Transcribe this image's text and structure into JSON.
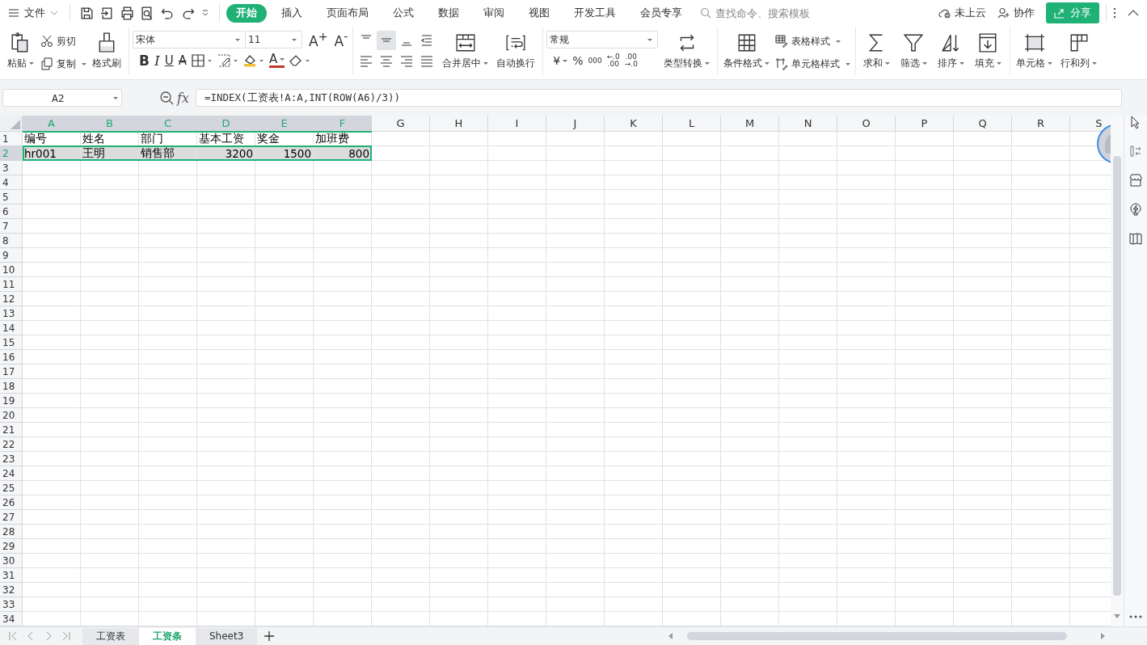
{
  "menu_bar": {
    "file_menu": "文件",
    "tabs": [
      {
        "label": "开始",
        "selected": true
      },
      {
        "label": "插入",
        "selected": false
      },
      {
        "label": "页面布局",
        "selected": false
      },
      {
        "label": "公式",
        "selected": false
      },
      {
        "label": "数据",
        "selected": false
      },
      {
        "label": "审阅",
        "selected": false
      },
      {
        "label": "视图",
        "selected": false
      },
      {
        "label": "开发工具",
        "selected": false
      },
      {
        "label": "会员专享",
        "selected": false
      }
    ],
    "search": {
      "placeholder": "查找命令、搜索模板"
    },
    "cloud_status": "未上云",
    "collaborate": "协作",
    "share": "分享"
  },
  "ribbon": {
    "paste": "粘贴",
    "cut": "剪切",
    "copy": "复制",
    "format_painter": "格式刷",
    "font_name": "宋体",
    "font_size": "11",
    "grow_font": "A$^{+}$",
    "shrink_font": "A$^{-}$",
    "bold": "B",
    "italic": "I",
    "underline": "U",
    "strikethrough": "A",
    "font_color": "A",
    "align_buttons": [
      {
        "selected": false
      },
      {
        "selected": true
      },
      {
        "selected": false
      },
      {
        "selected": false
      }
    ],
    "merge_center": "合并居中",
    "wrap_text": "自动换行",
    "number_format": "常规",
    "currency": "¥",
    "percent": "%",
    "thousands": "000",
    "decimal_increase": [
      "←.0",
      ".00"
    ],
    "decimal_decrease": [
      ".00",
      "→.0"
    ],
    "type_convert": "类型转换",
    "conditional_format": "条件格式",
    "table_style": "表格样式",
    "cell_style": "单元格样式",
    "sum": "求和",
    "filter": "筛选",
    "sort": "排序",
    "fill": "填充",
    "cell": "单元格",
    "rows_and_columns": "行和列"
  },
  "formula_bar": {
    "name_box": "A2",
    "fx": "fx",
    "formula": "=INDEX(工资表!A:A,INT(ROW(A6)/3))"
  },
  "sheet": {
    "columns": [
      {
        "label": "A",
        "selected": true
      },
      {
        "label": "B",
        "selected": true
      },
      {
        "label": "C",
        "selected": true
      },
      {
        "label": "D",
        "selected": true
      },
      {
        "label": "E",
        "selected": true
      },
      {
        "label": "F",
        "selected": true
      },
      {
        "label": "G",
        "selected": false
      },
      {
        "label": "H",
        "selected": false
      },
      {
        "label": "I",
        "selected": false
      },
      {
        "label": "J",
        "selected": false
      },
      {
        "label": "K",
        "selected": false
      },
      {
        "label": "L",
        "selected": false
      },
      {
        "label": "M",
        "selected": false
      },
      {
        "label": "N",
        "selected": false
      },
      {
        "label": "O",
        "selected": false
      },
      {
        "label": "P",
        "selected": false
      },
      {
        "label": "Q",
        "selected": false
      },
      {
        "label": "R",
        "selected": false
      },
      {
        "label": "S",
        "selected": false
      }
    ],
    "rows": [
      {
        "label": "1",
        "selected": false,
        "cells": [
          {
            "text": "编号",
            "kind": "text"
          },
          {
            "text": "姓名",
            "kind": "text"
          },
          {
            "text": "部门",
            "kind": "text"
          },
          {
            "text": "基本工资",
            "kind": "text"
          },
          {
            "text": "奖金",
            "kind": "text"
          },
          {
            "text": "加班费",
            "kind": "text"
          }
        ]
      },
      {
        "label": "2",
        "selected": true,
        "cells": [
          {
            "text": "hr001",
            "kind": "text"
          },
          {
            "text": "王明",
            "kind": "text"
          },
          {
            "text": "销售部",
            "kind": "text"
          },
          {
            "text": "3200",
            "kind": "number"
          },
          {
            "text": "1500",
            "kind": "number"
          },
          {
            "text": "800",
            "kind": "number"
          }
        ]
      },
      {
        "label": "3",
        "selected": false
      },
      {
        "label": "4",
        "selected": false
      },
      {
        "label": "5",
        "selected": false
      },
      {
        "label": "6",
        "selected": false
      },
      {
        "label": "7",
        "selected": false
      },
      {
        "label": "8",
        "selected": false
      },
      {
        "label": "9",
        "selected": false
      },
      {
        "label": "10",
        "selected": false
      },
      {
        "label": "11",
        "selected": false
      },
      {
        "label": "12",
        "selected": false
      },
      {
        "label": "13",
        "selected": false
      },
      {
        "label": "14",
        "selected": false
      },
      {
        "label": "15",
        "selected": false
      },
      {
        "label": "16",
        "selected": false
      },
      {
        "label": "17",
        "selected": false
      },
      {
        "label": "18",
        "selected": false
      },
      {
        "label": "19",
        "selected": false
      },
      {
        "label": "20",
        "selected": false
      },
      {
        "label": "21",
        "selected": false
      },
      {
        "label": "22",
        "selected": false
      },
      {
        "label": "23",
        "selected": false
      },
      {
        "label": "24",
        "selected": false
      },
      {
        "label": "25",
        "selected": false
      },
      {
        "label": "26",
        "selected": false
      },
      {
        "label": "27",
        "selected": false
      },
      {
        "label": "28",
        "selected": false
      },
      {
        "label": "29",
        "selected": false
      },
      {
        "label": "30",
        "selected": false
      },
      {
        "label": "31",
        "selected": false
      },
      {
        "label": "32",
        "selected": false
      },
      {
        "label": "33",
        "selected": false
      },
      {
        "label": "34",
        "selected": false
      }
    ]
  },
  "sheet_tabs": [
    {
      "label": "工资表",
      "selected": false
    },
    {
      "label": "工资条",
      "selected": true
    },
    {
      "label": "Sheet3",
      "selected": false
    }
  ]
}
